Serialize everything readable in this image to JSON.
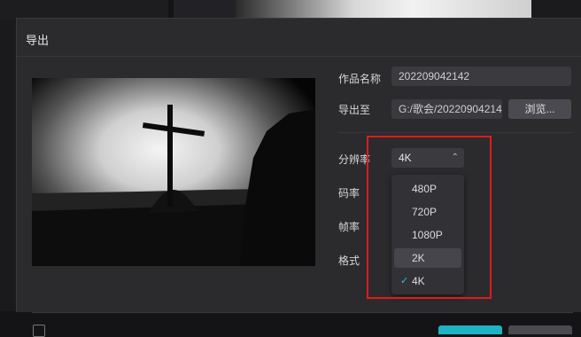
{
  "dialog": {
    "title": "导出"
  },
  "form": {
    "name_label": "作品名称",
    "name_value": "202209042142",
    "export_to_label": "导出至",
    "export_path": "G:/歌会/20220904214",
    "browse_label": "浏览...",
    "resolution_label": "分辨率",
    "resolution_value": "4K",
    "bitrate_label": "码率",
    "framerate_label": "帧率",
    "format_label": "格式"
  },
  "resolution_options": [
    "480P",
    "720P",
    "1080P",
    "2K",
    "4K"
  ],
  "selected_option": "4K",
  "hovered_option": "2K",
  "colors": {
    "accent": "#29c3d6",
    "highlight_box": "#e21a1a",
    "dialog_bg": "#2b2b2e"
  },
  "icons": {
    "chevron": "chevron-up-icon",
    "check": "check-icon"
  }
}
